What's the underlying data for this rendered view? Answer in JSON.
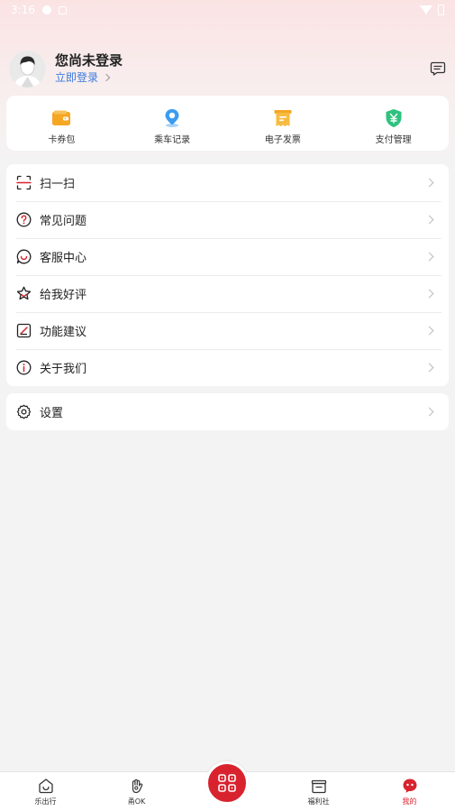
{
  "status_bar": {
    "time": "3:16"
  },
  "profile": {
    "name": "您尚未登录",
    "login_link": "立即登录"
  },
  "quick_actions": [
    {
      "label": "卡券包",
      "icon": "wallet-icon",
      "color": "#f5a623"
    },
    {
      "label": "乘车记录",
      "icon": "location-pin-icon",
      "color": "#3b9cf0"
    },
    {
      "label": "电子发票",
      "icon": "invoice-icon",
      "color": "#f5a623"
    },
    {
      "label": "支付管理",
      "icon": "yuan-shield-icon",
      "color": "#2ec27e"
    }
  ],
  "menu": {
    "scan": "扫一扫",
    "faq": "常见问题",
    "support": "客服中心",
    "rate": "给我好评",
    "feedback": "功能建议",
    "about": "关于我们",
    "settings": "设置"
  },
  "tabbar": {
    "tabs": [
      {
        "label": "乐出行",
        "icon": "home-smile-icon"
      },
      {
        "label": "甬OK",
        "icon": "ok-hand-icon"
      },
      {
        "label": "福利社",
        "icon": "gift-box-icon"
      },
      {
        "label": "我的",
        "icon": "profile-face-icon"
      }
    ],
    "active": "我的",
    "center_icon": "qr-code-icon"
  },
  "colors": {
    "accent": "#d8232e",
    "link": "#3a7be0"
  }
}
